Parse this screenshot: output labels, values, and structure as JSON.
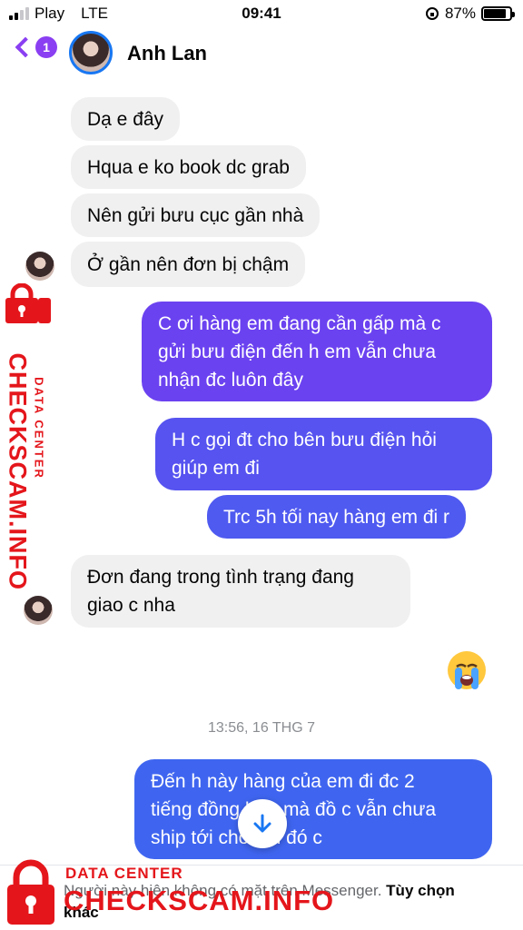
{
  "status_bar": {
    "carrier": "Play",
    "network": "LTE",
    "time": "09:41",
    "battery": "87%",
    "battery_level": 0.87
  },
  "header": {
    "back_badge": "1",
    "contact_name": "Anh Lan"
  },
  "messages": [
    {
      "text": "Dạ e đây",
      "direction": "incoming"
    },
    {
      "text": "Hqua e ko book dc grab",
      "direction": "incoming"
    },
    {
      "text": "Nên gửi bưu cục gần nhà",
      "direction": "incoming"
    },
    {
      "text": "Ở gần nên đơn bị chậm",
      "direction": "incoming"
    },
    {
      "line1": "C ơi hàng em đang cần gấp mà c",
      "line2": "gửi bưu điện đến h em vẫn chưa",
      "line3": "nhận đc luôn đây",
      "direction": "outgoing"
    },
    {
      "line1": "H c gọi đt cho bên bưu điện hỏi",
      "line2": "giúp em đi",
      "direction": "outgoing"
    },
    {
      "text": "Trc 5h tối nay hàng em đi r",
      "direction": "outgoing"
    },
    {
      "line1": "Đơn đang trong tình trạng đang",
      "line2": "giao c nha",
      "direction": "incoming"
    },
    {
      "line1": "Đến h này hàng của em đi đc 2",
      "line2": "tiếng đồng hồ r mà đồ c vẫn chưa",
      "line3": "ship tới cho em đó c",
      "direction": "outgoing"
    }
  ],
  "sticker": "crying-face-emoji",
  "timestamp": "13:56, 16 THG 7",
  "footer_notice": {
    "text": "Người này hiện không có mặt trên Messenger.",
    "link": "Tùy chọn khác"
  },
  "watermark": {
    "small": "DATA CENTER",
    "big": "CHECKSCAM.INFO"
  },
  "colors": {
    "accent": "#8a3ff2",
    "outgoing_purple": "#6b42f0",
    "outgoing_blue": "#3f65f0",
    "incoming_bg": "#f0f0f0",
    "watermark_red": "#e4161b"
  }
}
